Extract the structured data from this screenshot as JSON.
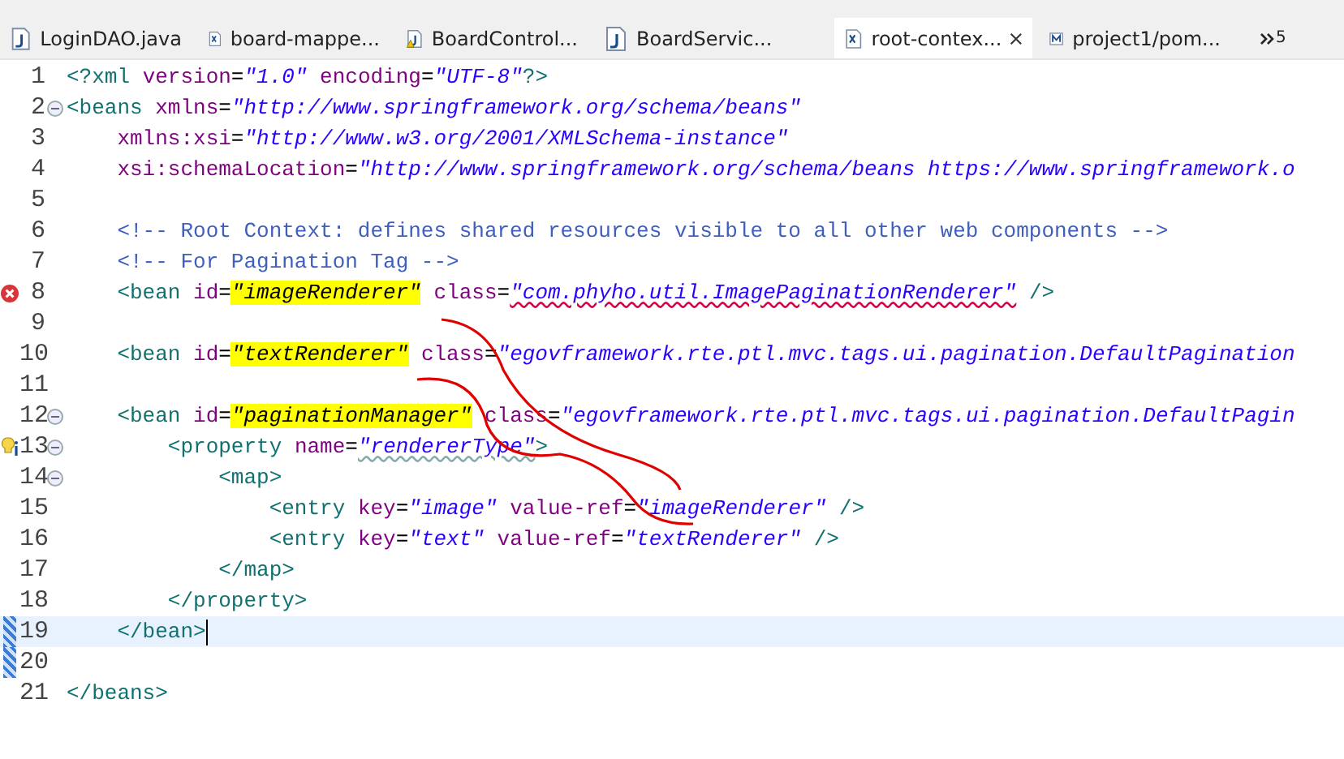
{
  "tabs": [
    {
      "label": "LoginDAO.java",
      "kind": "java",
      "warning": false,
      "selected": false
    },
    {
      "label": "board-mappe...",
      "kind": "xml",
      "warning": false,
      "selected": false
    },
    {
      "label": "BoardControl...",
      "kind": "java",
      "warning": true,
      "selected": false
    },
    {
      "label": "BoardServic...",
      "kind": "java",
      "warning": false,
      "selected": false
    },
    {
      "label": "root-contex...",
      "kind": "xml",
      "warning": false,
      "selected": true
    },
    {
      "label": "project1/pom...",
      "kind": "maven",
      "warning": false,
      "selected": false
    }
  ],
  "overflow": {
    "count": "5"
  },
  "lines": [
    {
      "number": "1",
      "tokens": [
        {
          "kind": "tag",
          "text": "<?xml "
        },
        {
          "kind": "attr",
          "text": "version"
        },
        {
          "kind": "eq",
          "text": "="
        },
        {
          "kind": "value",
          "text": "\"1.0\" "
        },
        {
          "kind": "attr",
          "text": "encoding"
        },
        {
          "kind": "eq",
          "text": "="
        },
        {
          "kind": "value",
          "text": "\"UTF-8\""
        },
        {
          "kind": "tag",
          "text": "?>"
        }
      ]
    },
    {
      "number": "2",
      "expanded": true,
      "tokens": [
        {
          "kind": "tag",
          "text": "<beans "
        },
        {
          "kind": "attr",
          "text": "xmlns"
        },
        {
          "kind": "eq",
          "text": "="
        },
        {
          "kind": "value",
          "text": "\"http://www.springframework.org/schema/beans\""
        }
      ]
    },
    {
      "number": "3",
      "tokens": [
        {
          "kind": "attr",
          "text": "    xmlns:xsi"
        },
        {
          "kind": "eq",
          "text": "="
        },
        {
          "kind": "value",
          "text": "\"http://www.w3.org/2001/XMLSchema-instance\""
        }
      ]
    },
    {
      "number": "4",
      "tokens": [
        {
          "kind": "attr",
          "text": "    xsi:schemaLocation"
        },
        {
          "kind": "eq",
          "text": "="
        },
        {
          "kind": "value",
          "text": "\"http://www.springframework.org/schema/beans https://www.springframework.o"
        }
      ]
    },
    {
      "number": "5"
    },
    {
      "number": "6",
      "tokens": [
        {
          "kind": "comment",
          "text": "    <!-- Root Context: defines shared resources visible to all other web components -->"
        }
      ]
    },
    {
      "number": "7",
      "tokens": [
        {
          "kind": "comment",
          "text": "    <!-- For Pagination Tag -->"
        }
      ]
    },
    {
      "number": "8",
      "error": true,
      "tokens": [
        {
          "kind": "tag",
          "text": "    <bean "
        },
        {
          "kind": "attr",
          "text": "id"
        },
        {
          "kind": "eq",
          "text": "="
        },
        {
          "kind": "value",
          "text": "\"imageRenderer\"",
          "highlighted": true
        },
        {
          "kind": "attr",
          "text": " class"
        },
        {
          "kind": "eq",
          "text": "="
        },
        {
          "kind": "value",
          "text": "\"com.phyho.util.ImagePaginationRenderer\"",
          "error": true
        },
        {
          "kind": "tag",
          "text": " />"
        }
      ]
    },
    {
      "number": "9"
    },
    {
      "number": "10",
      "tokens": [
        {
          "kind": "tag",
          "text": "    <bean "
        },
        {
          "kind": "attr",
          "text": "id"
        },
        {
          "kind": "eq",
          "text": "="
        },
        {
          "kind": "value",
          "text": "\"textRenderer\"",
          "highlighted": true
        },
        {
          "kind": "attr",
          "text": " class"
        },
        {
          "kind": "eq",
          "text": "="
        },
        {
          "kind": "value",
          "text": "\"egovframework.rte.ptl.mvc.tags.ui.pagination.DefaultPagination"
        }
      ]
    },
    {
      "number": "11"
    },
    {
      "number": "12",
      "expanded": true,
      "tokens": [
        {
          "kind": "tag",
          "text": "    <bean "
        },
        {
          "kind": "attr",
          "text": "id"
        },
        {
          "kind": "eq",
          "text": "="
        },
        {
          "kind": "value",
          "text": "\"paginationManager\"",
          "highlighted": true
        },
        {
          "kind": "attr",
          "text": " class"
        },
        {
          "kind": "eq",
          "text": "="
        },
        {
          "kind": "value",
          "text": "\"egovframework.rte.ptl.mvc.tags.ui.pagination.DefaultPagin"
        }
      ]
    },
    {
      "number": "13",
      "expanded": true,
      "quick_fix": true,
      "tokens": [
        {
          "kind": "tag",
          "text": "        <property "
        },
        {
          "kind": "attr",
          "text": "name"
        },
        {
          "kind": "eq",
          "text": "="
        },
        {
          "kind": "value",
          "text": "\"rendererType\"",
          "warning": true
        },
        {
          "kind": "tag",
          "text": ">"
        }
      ]
    },
    {
      "number": "14",
      "expanded": true,
      "tokens": [
        {
          "kind": "tag",
          "text": "            <map>"
        }
      ]
    },
    {
      "number": "15",
      "tokens": [
        {
          "kind": "tag",
          "text": "                <entry "
        },
        {
          "kind": "attr",
          "text": "key"
        },
        {
          "kind": "eq",
          "text": "="
        },
        {
          "kind": "value",
          "text": "\"image\" "
        },
        {
          "kind": "attr",
          "text": "value-ref"
        },
        {
          "kind": "eq",
          "text": "="
        },
        {
          "kind": "value",
          "text": "\"imageRenderer\""
        },
        {
          "kind": "tag",
          "text": " />"
        }
      ]
    },
    {
      "number": "16",
      "tokens": [
        {
          "kind": "tag",
          "text": "                <entry "
        },
        {
          "kind": "attr",
          "text": "key"
        },
        {
          "kind": "eq",
          "text": "="
        },
        {
          "kind": "value",
          "text": "\"text\" "
        },
        {
          "kind": "attr",
          "text": "value-ref"
        },
        {
          "kind": "eq",
          "text": "="
        },
        {
          "kind": "value",
          "text": "\"textRenderer\""
        },
        {
          "kind": "tag",
          "text": " />"
        }
      ]
    },
    {
      "number": "17",
      "tokens": [
        {
          "kind": "tag",
          "text": "            </map>"
        }
      ]
    },
    {
      "number": "18",
      "tokens": [
        {
          "kind": "tag",
          "text": "        </property>"
        }
      ]
    },
    {
      "number": "19",
      "current": true,
      "changed": true,
      "tokens": [
        {
          "kind": "tag",
          "text": "    </bean>"
        }
      ]
    },
    {
      "number": "20",
      "changed": true
    },
    {
      "number": "21",
      "tokens": [
        {
          "kind": "tag",
          "text": "</beans>"
        }
      ]
    }
  ]
}
